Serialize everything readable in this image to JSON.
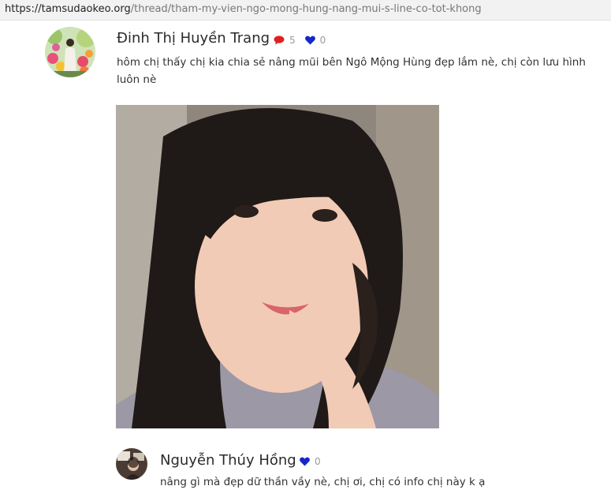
{
  "browser": {
    "url_host": "https://tamsudaokeo.org",
    "url_path": "/thread/tham-my-vien-ngo-mong-hung-nang-mui-s-line-co-tot-khong"
  },
  "post": {
    "author": "Đinh Thị Huyền Trang",
    "comment_icon": "speech-bubble-icon",
    "comment_count": "5",
    "like_icon": "heart-icon",
    "like_count": "0",
    "text": "hôm chị thấy chị kia chia sẻ nâng mũi bên Ngô Mộng Hùng đẹp lắm nè, chị còn lưu hình luôn nè"
  },
  "reply": {
    "author": "Nguyễn Thúy Hồng",
    "like_icon": "heart-icon",
    "like_count": "0",
    "text": "nâng gì mà đẹp dữ thần vầy nè, chị ơi, chị có info chị này k ạ"
  },
  "colors": {
    "comment_icon": "#e02020",
    "like_icon": "#1428c8"
  }
}
